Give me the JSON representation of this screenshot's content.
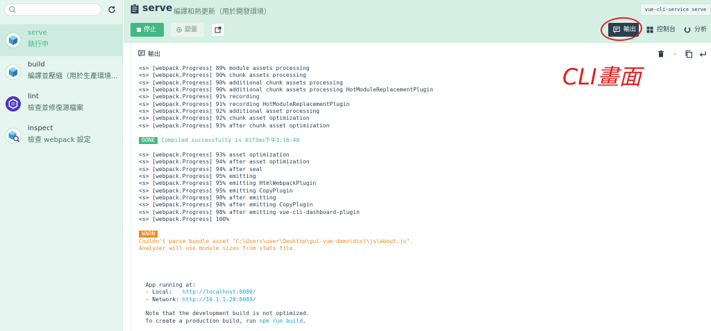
{
  "sidebar": {
    "search_placeholder": "",
    "tasks": [
      {
        "name": "serve",
        "desc": "執行中",
        "active": true
      },
      {
        "name": "build",
        "desc": "編譯並壓縮（用於生產環境..."
      },
      {
        "name": "lint",
        "desc": "檢查並修復源檔案"
      },
      {
        "name": "inspect",
        "desc": "檢查 webpack 設定"
      }
    ]
  },
  "header": {
    "title": "serve",
    "subtitle": "編譯和熱更新（用於開發環境）",
    "command": "vue-cli-service serve",
    "stop_label": "停止",
    "params_label": "變量",
    "output_label": "輸出",
    "dashboard_label": "控制台",
    "analyze_label": "分析"
  },
  "panel": {
    "title": "輸出"
  },
  "log": {
    "group1": [
      "<s> [webpack.Progress] 89% module assets processing",
      "<s> [webpack.Progress] 90% chunk assets processing",
      "<s> [webpack.Progress] 90% additional chunk assets processing",
      "<s> [webpack.Progress] 90% additional chunk assets processing HotModuleReplacementPlugin",
      "<s> [webpack.Progress] 91% recording",
      "<s> [webpack.Progress] 91% recording HotModuleReplacementPlugin",
      "<s> [webpack.Progress] 92% additional asset processing",
      "<s> [webpack.Progress] 92% chunk asset optimization",
      "<s> [webpack.Progress] 93% after chunk asset optimization"
    ],
    "done_badge": "DONE",
    "done_text": "Compiled successfully in 4173ms下午1:16:40",
    "group2": [
      "<s> [webpack.Progress] 93% asset optimization",
      "<s> [webpack.Progress] 94% after asset optimization",
      "<s> [webpack.Progress] 94% after seal",
      "<s> [webpack.Progress] 95% emitting",
      "<s> [webpack.Progress] 95% emitting HtmlWebpackPlugin",
      "<s> [webpack.Progress] 95% emitting CopyPlugin",
      "<s> [webpack.Progress] 98% after emitting",
      "<s> [webpack.Progress] 98% after emitting CopyPlugin",
      "<s> [webpack.Progress] 98% after emitting vue-cli-dashboard-plugin",
      "<s> [webpack.Progress] 100%"
    ],
    "warn_badge": "WARN",
    "warn_line1": "Couldn't parse bundle asset \"C:\\Users\\user\\Desktop\\gui-vue-demo\\dist\\js\\about.js\".",
    "warn_line2": "Analyzer will use module sizes from stats file.",
    "app_running": "  App running at:",
    "local_label": "  - Local:   ",
    "local_url": "http://localhost:8080/",
    "network_label": "  - Network: ",
    "network_url": "http://10.1.1.20:8080/",
    "note1": "  Note that the development build is not optimized.",
    "note2_prefix": "  To create a production build, run ",
    "note2_cmd": "npm run build",
    "note2_suffix": "."
  },
  "annotation": {
    "text": "CLI畫面"
  },
  "colors": {
    "accent": "#42b983",
    "dark": "#2c3e50",
    "warn": "#f08a1c",
    "link": "#1aa3c9",
    "annotation": "#e0201c"
  }
}
